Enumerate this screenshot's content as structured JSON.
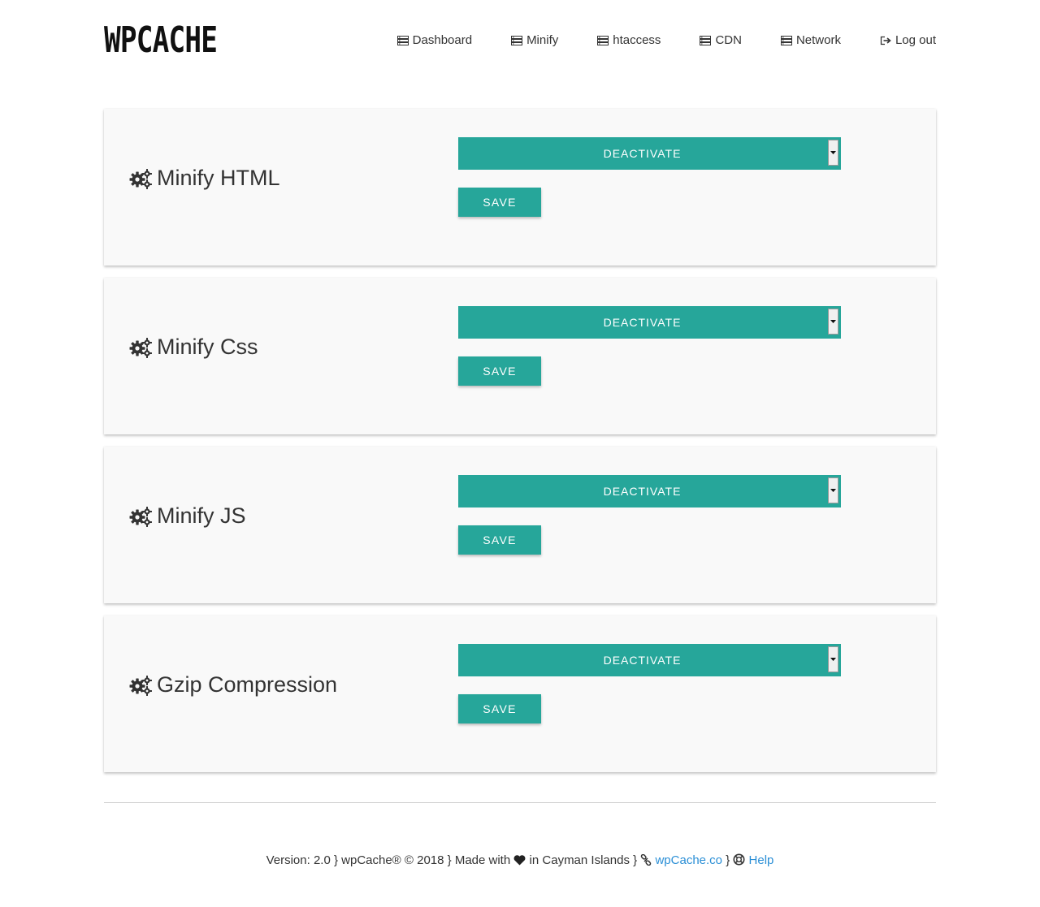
{
  "brand": {
    "logo": "WPCACHE"
  },
  "nav": [
    {
      "label": "Dashboard",
      "icon": "server-icon"
    },
    {
      "label": "Minify",
      "icon": "server-icon"
    },
    {
      "label": "htaccess",
      "icon": "server-icon"
    },
    {
      "label": "CDN",
      "icon": "server-icon"
    },
    {
      "label": "Network",
      "icon": "server-icon"
    },
    {
      "label": "Log out",
      "icon": "sign-out-icon"
    }
  ],
  "settings": [
    {
      "title": "Minify HTML",
      "icon": "gears-icon",
      "select_value": "DEACTIVATE",
      "save_label": "SAVE"
    },
    {
      "title": "Minify Css",
      "icon": "gears-icon",
      "select_value": "DEACTIVATE",
      "save_label": "SAVE"
    },
    {
      "title": "Minify JS",
      "icon": "gears-icon",
      "select_value": "DEACTIVATE",
      "save_label": "SAVE"
    },
    {
      "title": "Gzip Compression",
      "icon": "gears-icon",
      "select_value": "DEACTIVATE",
      "save_label": "SAVE"
    }
  ],
  "footer": {
    "version_text": "Version: 2.0 } wpCache® © 2018 } Made with",
    "location_text": "in Cayman Islands }",
    "site_link": "wpCache.co",
    "separator": "}",
    "help_link": "Help"
  },
  "colors": {
    "accent": "#26a69a",
    "link": "#2b8fd6",
    "card_bg": "#f9f9f9"
  }
}
